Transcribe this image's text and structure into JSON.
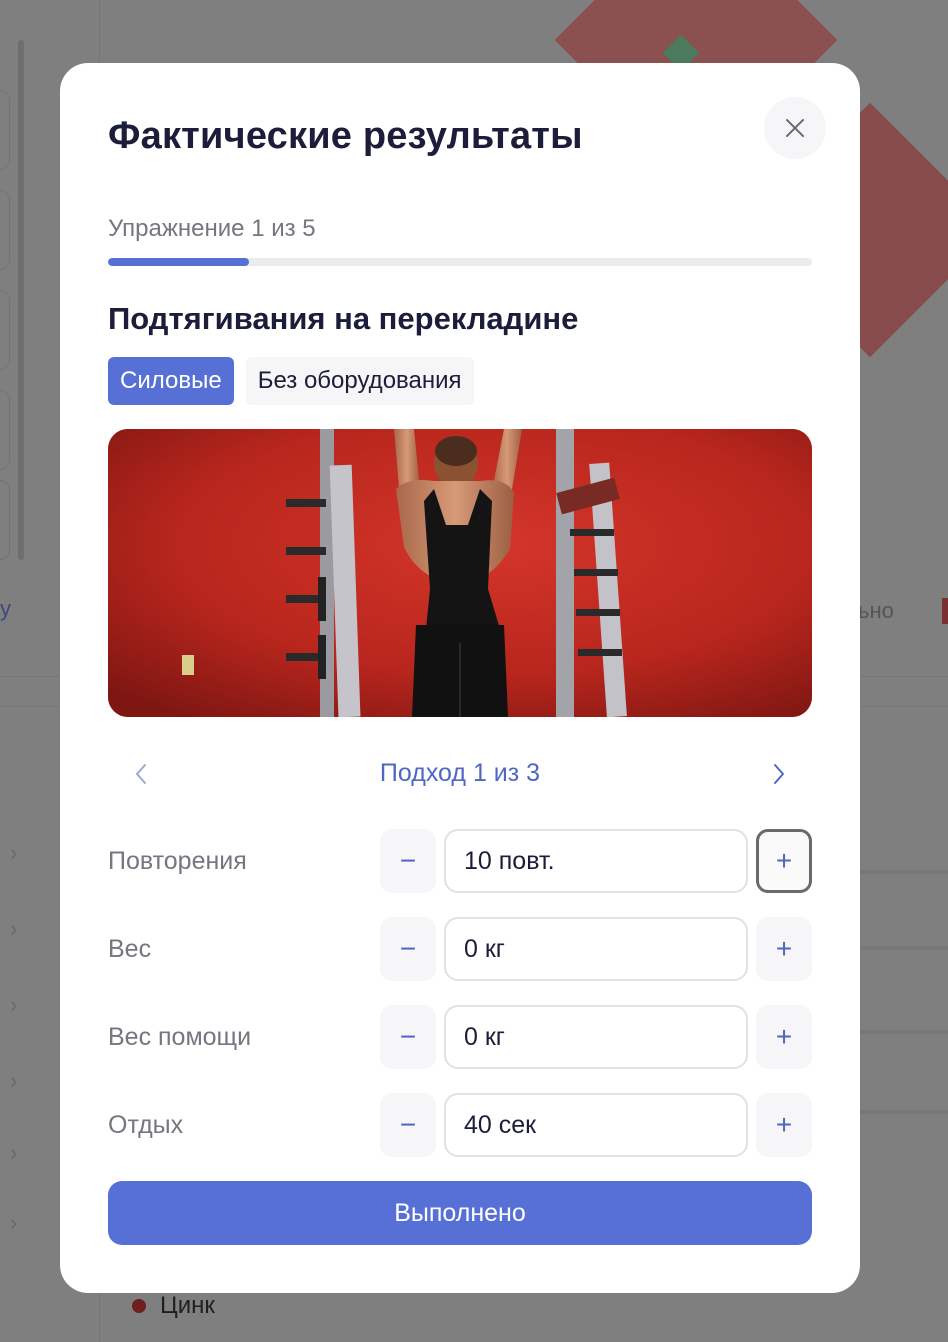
{
  "modal": {
    "title": "Фактические результаты",
    "progress": {
      "label": "Упражнение 1 из 5",
      "current": 1,
      "total": 5,
      "fraction": 0.2,
      "color": "#5770d6"
    },
    "exercise": {
      "name": "Подтягивания на перекладине",
      "tags": [
        "Силовые",
        "Без оборудования"
      ]
    },
    "set_nav": {
      "label": "Подход 1 из 3",
      "prev_icon": "chevron-left-icon",
      "next_icon": "chevron-right-icon"
    },
    "fields": [
      {
        "label": "Повторения",
        "value": "10 повт.",
        "minus": "−",
        "plus": "+"
      },
      {
        "label": "Вес",
        "value": "0 кг",
        "minus": "−",
        "plus": "+"
      },
      {
        "label": "Вес помощи",
        "value": "0 кг",
        "minus": "−",
        "plus": "+"
      },
      {
        "label": "Отдых",
        "value": "40 сек",
        "minus": "−",
        "plus": "+"
      }
    ],
    "done_label": "Выполнено",
    "close_icon": "close-icon",
    "accent_color": "#5670d5"
  },
  "background": {
    "left_fragment": "у",
    "right_fragment": "ьно",
    "legend_item": "Цинк"
  }
}
